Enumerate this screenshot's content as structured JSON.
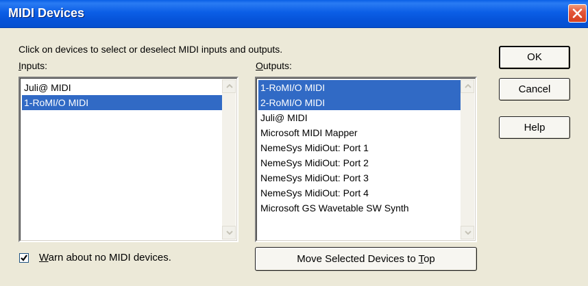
{
  "window": {
    "title": "MIDI Devices"
  },
  "instructions": "Click on devices to select or deselect MIDI inputs and outputs.",
  "inputs": {
    "label_first": "I",
    "label_rest": "nputs:",
    "items": [
      {
        "label": "Juli@ MIDI",
        "selected": false
      },
      {
        "label": "1-RoMI/O MIDI",
        "selected": true
      }
    ]
  },
  "outputs": {
    "label_first": "O",
    "label_rest": "utputs:",
    "items": [
      {
        "label": "1-RoMI/O MIDI",
        "selected": true
      },
      {
        "label": "2-RoMI/O MIDI",
        "selected": true
      },
      {
        "label": "Juli@ MIDI",
        "selected": false
      },
      {
        "label": "Microsoft MIDI Mapper",
        "selected": false
      },
      {
        "label": "NemeSys MidiOut: Port 1",
        "selected": false
      },
      {
        "label": "NemeSys MidiOut: Port 2",
        "selected": false
      },
      {
        "label": "NemeSys MidiOut: Port 3",
        "selected": false
      },
      {
        "label": "NemeSys MidiOut: Port 4",
        "selected": false
      },
      {
        "label": "Microsoft GS Wavetable SW Synth",
        "selected": false
      }
    ]
  },
  "buttons": {
    "ok": "OK",
    "cancel": "Cancel",
    "help": "Help",
    "move_prefix": "Move Selected Devices to ",
    "move_accel": "T",
    "move_suffix": "op"
  },
  "warn": {
    "checked": true,
    "label_first": "W",
    "label_rest": "arn about no MIDI devices."
  },
  "colors": {
    "selection": "#316ac5",
    "titlebar": "#0b5ee6",
    "dialog_bg": "#ece9d8"
  }
}
